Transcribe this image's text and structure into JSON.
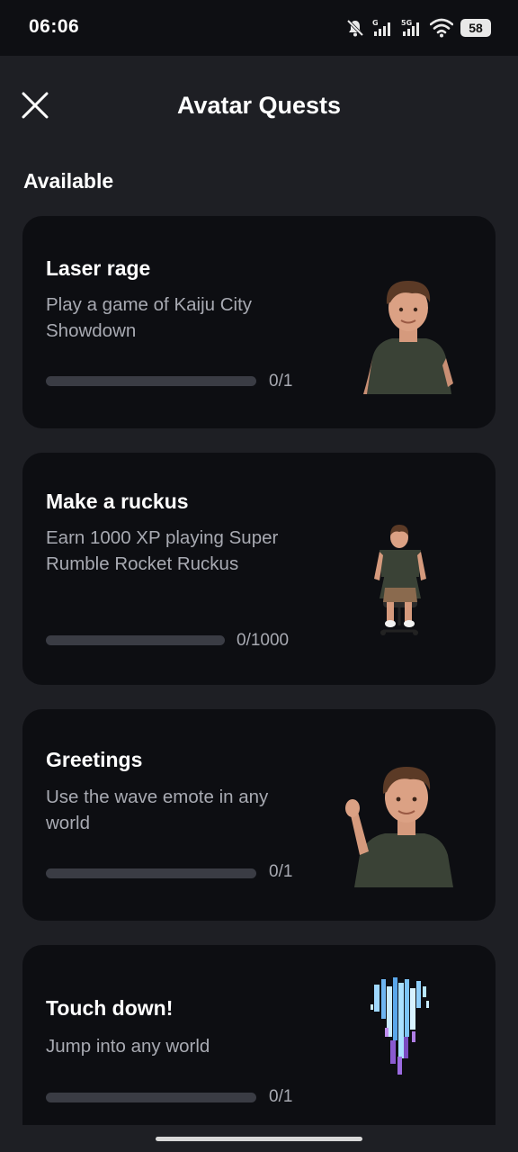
{
  "status_bar": {
    "time": "06:06",
    "battery": "58",
    "icons": [
      "bell-muted-icon",
      "signal-g-icon",
      "signal-5g-icon",
      "wifi-icon",
      "battery-icon"
    ]
  },
  "header": {
    "title": "Avatar Quests",
    "close_icon": "close-icon"
  },
  "section": {
    "title": "Available"
  },
  "quests": [
    {
      "title": "Laser rage",
      "description": "Play a game of Kaiju City Showdown",
      "progress_text": "0/1",
      "progress": 0,
      "image": "avatar-standing"
    },
    {
      "title": "Make a ruckus",
      "description": "Earn 1000 XP playing Super Rumble Rocket Ruckus",
      "progress_text": "0/1000",
      "progress": 0,
      "image": "avatar-sitting-chair"
    },
    {
      "title": "Greetings",
      "description": "Use the wave emote in any world",
      "progress_text": "0/1",
      "progress": 0,
      "image": "avatar-waving"
    },
    {
      "title": "Touch down!",
      "description": "Jump into any world",
      "progress_text": "0/1",
      "progress": 0,
      "image": "avatar-teleport-pixels"
    }
  ],
  "colors": {
    "background": "#1e1f24",
    "card": "#0d0e12",
    "status_bar": "#0e0f13",
    "secondary_text": "#a8aab2",
    "progress_track": "#3a3c44"
  }
}
